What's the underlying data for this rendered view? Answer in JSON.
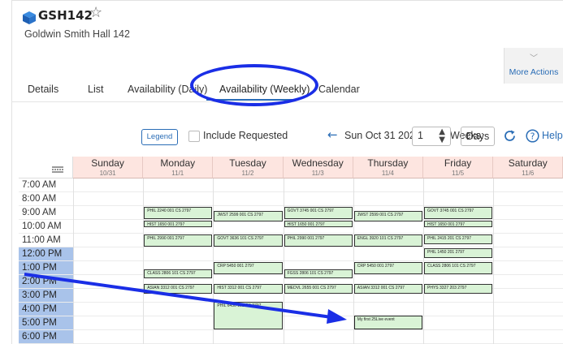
{
  "header": {
    "room_code": "GSH142",
    "room_name": "Goldwin Smith Hall 142"
  },
  "more_actions": {
    "label": "More Actions"
  },
  "tabs": [
    {
      "label": "Details"
    },
    {
      "label": "List"
    },
    {
      "label": "Availability (Daily)"
    },
    {
      "label": "Availability (Weekly)"
    },
    {
      "label": "Calendar"
    }
  ],
  "toolbar": {
    "legend_label": "Legend",
    "include_requested_label": "Include Requested",
    "date_label": "Sun Oct 31 2021",
    "weeks_label": "Weeks:",
    "weeks_value": "1",
    "days_label": "Days",
    "help_label": "Help"
  },
  "grid": {
    "days": [
      {
        "name": "Sunday",
        "date": "10/31"
      },
      {
        "name": "Monday",
        "date": "11/1"
      },
      {
        "name": "Tuesday",
        "date": "11/2"
      },
      {
        "name": "Wednesday",
        "date": "11/3"
      },
      {
        "name": "Thursday",
        "date": "11/4"
      },
      {
        "name": "Friday",
        "date": "11/5"
      },
      {
        "name": "Saturday",
        "date": "11/6"
      }
    ],
    "times": [
      "7:00 AM",
      "8:00 AM",
      "9:00 AM",
      "10:00 AM",
      "11:00 AM",
      "12:00 PM",
      "1:00 PM",
      "2:00 PM",
      "3:00 PM",
      "4:00 PM",
      "5:00 PM",
      "6:00 PM"
    ],
    "highlighted_times": [
      "12:00 PM",
      "1:00 PM",
      "2:00 PM",
      "3:00 PM",
      "4:00 PM",
      "5:00 PM",
      "6:00 PM"
    ],
    "events": [
      {
        "day": 1,
        "start": 9.0,
        "end": 10.0,
        "label": "PHIL 2240 001 CS 2797"
      },
      {
        "day": 1,
        "start": 10.0,
        "end": 10.6,
        "label": "HIST 1650 001 2797"
      },
      {
        "day": 1,
        "start": 11.0,
        "end": 12.0,
        "label": "PHIL 2990 001 2797"
      },
      {
        "day": 1,
        "start": 13.5,
        "end": 14.3,
        "label": "CLASS 2806 101 CS 2797"
      },
      {
        "day": 1,
        "start": 14.6,
        "end": 15.4,
        "label": "ASIAN 3312 001 CS 2797"
      },
      {
        "day": 2,
        "start": 9.3,
        "end": 10.2,
        "label": "JWST 2599 001 CS 2797"
      },
      {
        "day": 2,
        "start": 11.0,
        "end": 12.0,
        "label": "GOVT 3636 101 CS 2797"
      },
      {
        "day": 2,
        "start": 13.0,
        "end": 14.0,
        "label": "CRP 5450 001 2797"
      },
      {
        "day": 2,
        "start": 14.6,
        "end": 15.4,
        "label": "HIST 3312 001 CS 2797"
      },
      {
        "day": 2,
        "start": 15.9,
        "end": 18.0,
        "label": "PHIL 6430 101 CS 2797"
      },
      {
        "day": 3,
        "start": 9.0,
        "end": 10.0,
        "label": "GOVT 3745 001 CS 2797"
      },
      {
        "day": 3,
        "start": 10.0,
        "end": 10.6,
        "label": "HIST 1650 001 2797"
      },
      {
        "day": 3,
        "start": 11.0,
        "end": 12.0,
        "label": "PHIL 2990 001 2797"
      },
      {
        "day": 3,
        "start": 13.5,
        "end": 14.3,
        "label": "FGSS 2806 101 CS 2797"
      },
      {
        "day": 3,
        "start": 14.6,
        "end": 15.4,
        "label": "MEDVL 2655 001 CS 2797"
      },
      {
        "day": 4,
        "start": 9.3,
        "end": 10.2,
        "label": "JWST 2599 001 CS 2797"
      },
      {
        "day": 4,
        "start": 11.0,
        "end": 12.0,
        "label": "ENGL 3920 101 CS 2797"
      },
      {
        "day": 4,
        "start": 13.0,
        "end": 14.0,
        "label": "CRP 5450 001 2797"
      },
      {
        "day": 4,
        "start": 14.6,
        "end": 15.4,
        "label": "ASIAN 3312 001 CS 2797"
      },
      {
        "day": 4,
        "start": 16.9,
        "end": 18.0,
        "label": "My first 25Live event",
        "mine": true
      },
      {
        "day": 5,
        "start": 9.0,
        "end": 10.0,
        "label": "GOVT 3745 001 CS 2797"
      },
      {
        "day": 5,
        "start": 10.0,
        "end": 10.6,
        "label": "HIST 1650 001 2797"
      },
      {
        "day": 5,
        "start": 11.0,
        "end": 11.8,
        "label": "PHIL 2415 201 CS 2797"
      },
      {
        "day": 5,
        "start": 12.0,
        "end": 12.8,
        "label": "PHIL 1450 201 2797"
      },
      {
        "day": 5,
        "start": 13.0,
        "end": 14.0,
        "label": "CLASS 2806 101 CS 2797"
      },
      {
        "day": 5,
        "start": 14.6,
        "end": 15.4,
        "label": "PHYS 3327 203 2797"
      }
    ]
  },
  "colors": {
    "accent": "#2a6db6",
    "header_bg": "#fde5e0",
    "event_bg": "#d9f3d6",
    "time_highlight": "#a9c3ea",
    "annotation": "#1a2ee6"
  }
}
